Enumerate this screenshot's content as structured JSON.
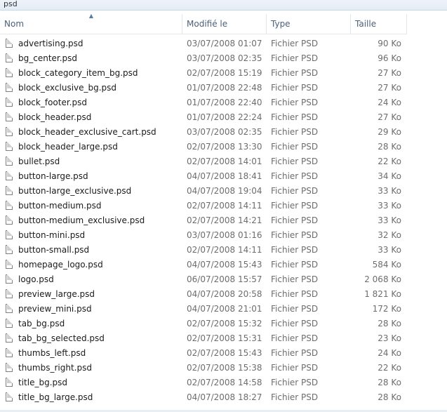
{
  "window": {
    "title": "psd"
  },
  "header": {
    "name": "Nom",
    "modified": "Modifié le",
    "type": "Type",
    "size": "Taille"
  },
  "icons": {
    "file": "file-icon",
    "sort": "sort-ascending-icon"
  },
  "files": [
    {
      "name": "advertising.psd",
      "date": "03/07/2008 01:07",
      "type": "Fichier PSD",
      "size": "90 Ko"
    },
    {
      "name": "bg_center.psd",
      "date": "03/07/2008 02:35",
      "type": "Fichier PSD",
      "size": "96 Ko"
    },
    {
      "name": "block_category_item_bg.psd",
      "date": "02/07/2008 15:19",
      "type": "Fichier PSD",
      "size": "27 Ko"
    },
    {
      "name": "block_exclusive_bg.psd",
      "date": "01/07/2008 22:48",
      "type": "Fichier PSD",
      "size": "27 Ko"
    },
    {
      "name": "block_footer.psd",
      "date": "01/07/2008 22:40",
      "type": "Fichier PSD",
      "size": "24 Ko"
    },
    {
      "name": "block_header.psd",
      "date": "01/07/2008 22:24",
      "type": "Fichier PSD",
      "size": "27 Ko"
    },
    {
      "name": "block_header_exclusive_cart.psd",
      "date": "03/07/2008 02:35",
      "type": "Fichier PSD",
      "size": "29 Ko"
    },
    {
      "name": "block_header_large.psd",
      "date": "02/07/2008 13:30",
      "type": "Fichier PSD",
      "size": "28 Ko"
    },
    {
      "name": "bullet.psd",
      "date": "02/07/2008 14:01",
      "type": "Fichier PSD",
      "size": "22 Ko"
    },
    {
      "name": "button-large.psd",
      "date": "04/07/2008 18:41",
      "type": "Fichier PSD",
      "size": "34 Ko"
    },
    {
      "name": "button-large_exclusive.psd",
      "date": "04/07/2008 19:04",
      "type": "Fichier PSD",
      "size": "33 Ko"
    },
    {
      "name": "button-medium.psd",
      "date": "02/07/2008 14:11",
      "type": "Fichier PSD",
      "size": "33 Ko"
    },
    {
      "name": "button-medium_exclusive.psd",
      "date": "02/07/2008 14:21",
      "type": "Fichier PSD",
      "size": "33 Ko"
    },
    {
      "name": "button-mini.psd",
      "date": "03/07/2008 01:16",
      "type": "Fichier PSD",
      "size": "32 Ko"
    },
    {
      "name": "button-small.psd",
      "date": "02/07/2008 14:11",
      "type": "Fichier PSD",
      "size": "33 Ko"
    },
    {
      "name": "homepage_logo.psd",
      "date": "04/07/2008 15:43",
      "type": "Fichier PSD",
      "size": "584 Ko"
    },
    {
      "name": "logo.psd",
      "date": "06/07/2008 15:57",
      "type": "Fichier PSD",
      "size": "2 068 Ko"
    },
    {
      "name": "preview_large.psd",
      "date": "04/07/2008 20:58",
      "type": "Fichier PSD",
      "size": "1 821 Ko"
    },
    {
      "name": "preview_mini.psd",
      "date": "04/07/2008 21:01",
      "type": "Fichier PSD",
      "size": "172 Ko"
    },
    {
      "name": "tab_bg.psd",
      "date": "02/07/2008 15:32",
      "type": "Fichier PSD",
      "size": "28 Ko"
    },
    {
      "name": "tab_bg_selected.psd",
      "date": "02/07/2008 15:31",
      "type": "Fichier PSD",
      "size": "23 Ko"
    },
    {
      "name": "thumbs_left.psd",
      "date": "02/07/2008 15:43",
      "type": "Fichier PSD",
      "size": "24 Ko"
    },
    {
      "name": "thumbs_right.psd",
      "date": "02/07/2008 15:38",
      "type": "Fichier PSD",
      "size": "22 Ko"
    },
    {
      "name": "title_bg.psd",
      "date": "02/07/2008 14:58",
      "type": "Fichier PSD",
      "size": "28 Ko"
    },
    {
      "name": "title_bg_large.psd",
      "date": "04/07/2008 18:27",
      "type": "Fichier PSD",
      "size": "28 Ko"
    }
  ]
}
